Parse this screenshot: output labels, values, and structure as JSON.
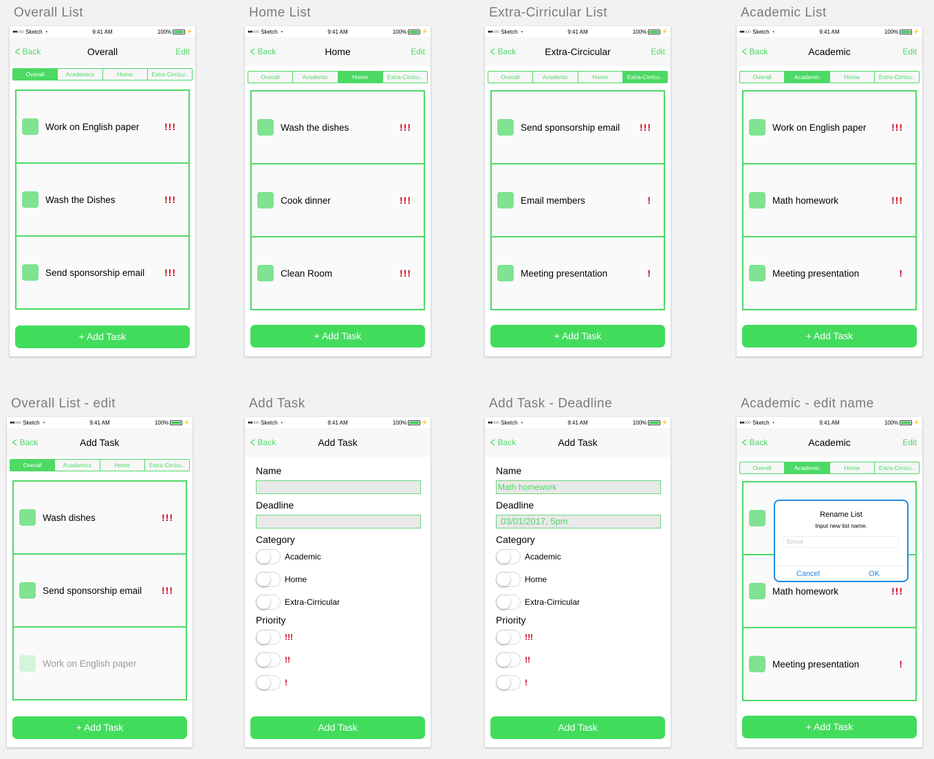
{
  "common": {
    "carrier": "Sketch",
    "time": "9:41 AM",
    "battery": "100%",
    "back": "Back",
    "edit": "Edit",
    "add_task": "+ Add Task",
    "accent_color": "#4cd964",
    "priority_color": "#d0021b"
  },
  "screens": [
    {
      "artboard": "Overall List",
      "nav_title": "Overall",
      "tabs": [
        "Overall",
        "Academics",
        "Home",
        "Extra-Circicu.."
      ],
      "active_tab": 0,
      "tasks": [
        {
          "label": "Work on English paper",
          "priority": "!!!"
        },
        {
          "label": "Wash the Dishes",
          "priority": "!!!"
        },
        {
          "label": "Send sponsorship email",
          "priority": "!!!"
        }
      ]
    },
    {
      "artboard": "Home List",
      "nav_title": "Home",
      "tabs": [
        "Overall",
        "Academic",
        "Home",
        "Extra-Cirricu.."
      ],
      "active_tab": 2,
      "tasks": [
        {
          "label": "Wash the dishes",
          "priority": "!!!"
        },
        {
          "label": "Cook dinner",
          "priority": "!!!"
        },
        {
          "label": "Clean Room",
          "priority": "!!!"
        }
      ]
    },
    {
      "artboard": "Extra-Cirricular List",
      "nav_title": "Extra-Circicular",
      "tabs": [
        "Overall",
        "Academic",
        "Home",
        "Extra-Cirricu.."
      ],
      "active_tab": 3,
      "tasks": [
        {
          "label": "Send sponsorship email",
          "priority": "!!!"
        },
        {
          "label": "Email members",
          "priority": "!"
        },
        {
          "label": "Meeting presentation",
          "priority": "!"
        }
      ]
    },
    {
      "artboard": "Academic List",
      "nav_title": "Academic",
      "tabs": [
        "Overall",
        "Academic",
        "Home",
        "Extra-Cirricu.."
      ],
      "active_tab": 1,
      "tasks": [
        {
          "label": "Work on English paper",
          "priority": "!!!"
        },
        {
          "label": "Math homework",
          "priority": "!!!"
        },
        {
          "label": "Meeting presentation",
          "priority": "!"
        }
      ]
    },
    {
      "artboard": "Overall List - edit",
      "nav_title": "Add Task",
      "tabs": [
        "Overall",
        "Academics",
        "Home",
        "Extra-Cirricu.."
      ],
      "active_tab": 0,
      "tasks": [
        {
          "label": "Wash dishes",
          "priority": "!!!"
        },
        {
          "label": "Send sponsorship email",
          "priority": "!!!"
        },
        {
          "label": "Work on English paper",
          "priority": ""
        }
      ]
    },
    {
      "artboard": "Add Task",
      "nav_title": "Add Task",
      "form": {
        "name_label": "Name",
        "name_value": "",
        "deadline_label": "Deadline",
        "deadline_value": "",
        "category_label": "Category",
        "categories": [
          "Academic",
          "Home",
          "Extra-Cirricular"
        ],
        "priority_label": "Priority",
        "priorities": [
          "!!!",
          "!!",
          "!"
        ],
        "submit": "Add Task"
      }
    },
    {
      "artboard": "Add Task - Deadline",
      "nav_title": "Add Task",
      "form": {
        "name_label": "Name",
        "name_value": "Math homework",
        "deadline_label": "Deadline",
        "deadline_value": "03/01/2017, 5pm",
        "category_label": "Category",
        "categories": [
          "Academic",
          "Home",
          "Extra-Cirricular"
        ],
        "priority_label": "Priority",
        "priorities": [
          "!!!",
          "!!",
          "!"
        ],
        "submit": "Add Task"
      }
    },
    {
      "artboard": "Academic - edit name",
      "nav_title": "Academic",
      "tabs": [
        "Overall",
        "Academic",
        "Home",
        "Extra-Cirricu.."
      ],
      "active_tab": 1,
      "tasks": [
        {
          "label": "",
          "priority": ""
        },
        {
          "label": "Math homework",
          "priority": "!!!"
        },
        {
          "label": "Meeting presentation",
          "priority": "!"
        }
      ],
      "dialog": {
        "title": "Rename List",
        "message": "Input new list name.",
        "placeholder": "School",
        "cancel": "Cancel",
        "ok": "OK"
      }
    }
  ]
}
